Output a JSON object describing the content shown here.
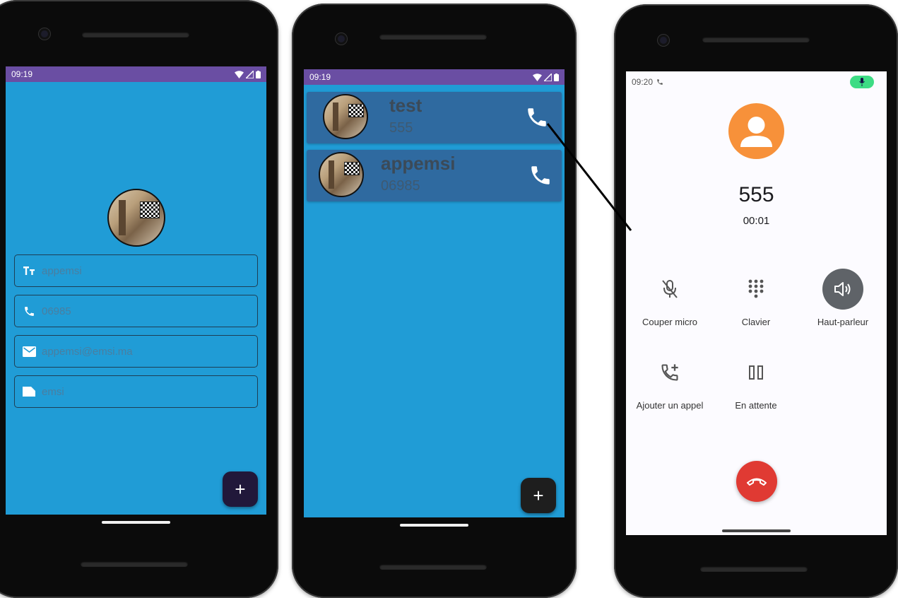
{
  "phone1": {
    "status": {
      "time": "09:19"
    },
    "form": {
      "name": "appemsi",
      "phone": "06985",
      "email": "appemsi@emsi.ma",
      "note": "emsi"
    },
    "fab_label": "+",
    "icons": [
      "text-format-icon",
      "phone-icon",
      "email-icon",
      "label-icon"
    ]
  },
  "phone2": {
    "status": {
      "time": "09:19"
    },
    "contacts": [
      {
        "name": "test",
        "number": "555"
      },
      {
        "name": "appemsi",
        "number": "06985"
      }
    ],
    "fab_label": "+"
  },
  "phone3": {
    "status": {
      "time": "09:20"
    },
    "caller_number": "555",
    "call_timer": "00:01",
    "actions": [
      {
        "label": "Couper micro",
        "icon": "mic-off-icon"
      },
      {
        "label": "Clavier",
        "icon": "dialpad-icon"
      },
      {
        "label": "Haut-parleur",
        "icon": "speaker-icon",
        "active": true
      },
      {
        "label": "Ajouter un appel",
        "icon": "add-call-icon"
      },
      {
        "label": "En attente",
        "icon": "pause-icon"
      }
    ]
  },
  "colors": {
    "app_background": "#209cd6",
    "status_bar": "#6a4ea3",
    "card": "#2f6aa0",
    "fab_phone1": "#21183a",
    "fab_phone2": "#1e1e1e",
    "caller_avatar": "#f7913a",
    "end_call": "#e03a33",
    "mic_indicator": "#3ddc84"
  }
}
